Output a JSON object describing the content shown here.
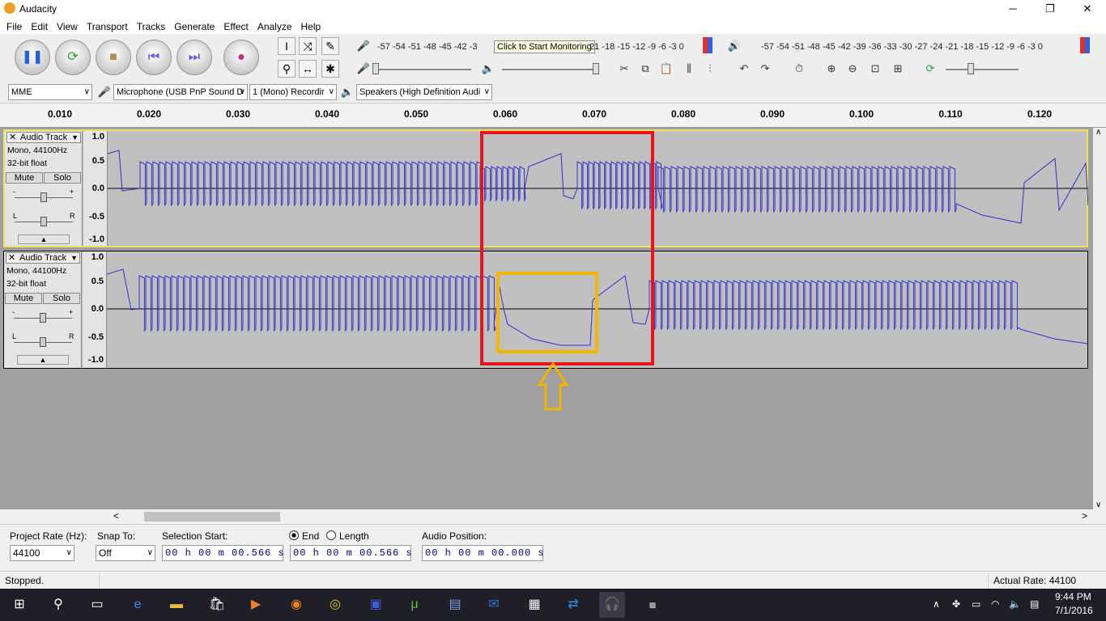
{
  "window": {
    "title": "Audacity",
    "minimize_glyph": "─",
    "maximize_glyph": "❐",
    "close_glyph": "✕"
  },
  "menu": [
    "File",
    "Edit",
    "View",
    "Transport",
    "Tracks",
    "Generate",
    "Effect",
    "Analyze",
    "Help"
  ],
  "toolbar": {
    "meter_ticks_record": "-57 -54 -51 -48 -45 -42 -3",
    "meter_ticks_record_tail": "21 -18 -15 -12  -9  -6  -3  0",
    "monitor_tooltip": "Click to Start Monitoring",
    "meter_ticks_play": "-57 -54 -51 -48 -45 -42 -39 -36 -33 -30 -27 -24 -21 -18 -15 -12  -9  -6  -3  0",
    "meter_lr": "L R"
  },
  "devices": {
    "host": "MME",
    "input": "Microphone (USB PnP Sound D",
    "channels": "1 (Mono) Recordir",
    "output": "Speakers (High Definition Audi"
  },
  "ruler": [
    "0.010",
    "0.020",
    "0.030",
    "0.040",
    "0.050",
    "0.060",
    "0.070",
    "0.080",
    "0.090",
    "0.100",
    "0.110",
    "0.120"
  ],
  "tracks": [
    {
      "name": "Audio Track",
      "format": "Mono, 44100Hz",
      "bits": "32-bit float",
      "mute": "Mute",
      "solo": "Solo",
      "gain_minus": "-",
      "gain_plus": "+",
      "pan_l": "L",
      "pan_r": "R"
    },
    {
      "name": "Audio Track",
      "format": "Mono, 44100Hz",
      "bits": "32-bit float",
      "mute": "Mute",
      "solo": "Solo",
      "gain_minus": "-",
      "gain_plus": "+",
      "pan_l": "L",
      "pan_r": "R"
    }
  ],
  "scale": [
    "1.0",
    "0.5",
    "0.0",
    "-0.5",
    "-1.0"
  ],
  "selection": {
    "rate_label": "Project Rate (Hz):",
    "rate_value": "44100",
    "snap_label": "Snap To:",
    "snap_value": "Off",
    "start_label": "Selection Start:",
    "start_value": "00 h 00 m 00.566 s",
    "end_label": "End",
    "length_label": "Length",
    "end_value": "00 h 00 m 00.566 s",
    "pos_label": "Audio Position:",
    "pos_value": "00 h 00 m 00.000 s"
  },
  "status": {
    "left": "Stopped.",
    "right": "Actual Rate: 44100"
  },
  "taskbar": {
    "time": "9:44 PM",
    "date": "7/1/2016"
  },
  "colors": {
    "waveform": "#3232c8",
    "annotation_red": "#e8141c",
    "annotation_yellow": "#f5b400"
  }
}
